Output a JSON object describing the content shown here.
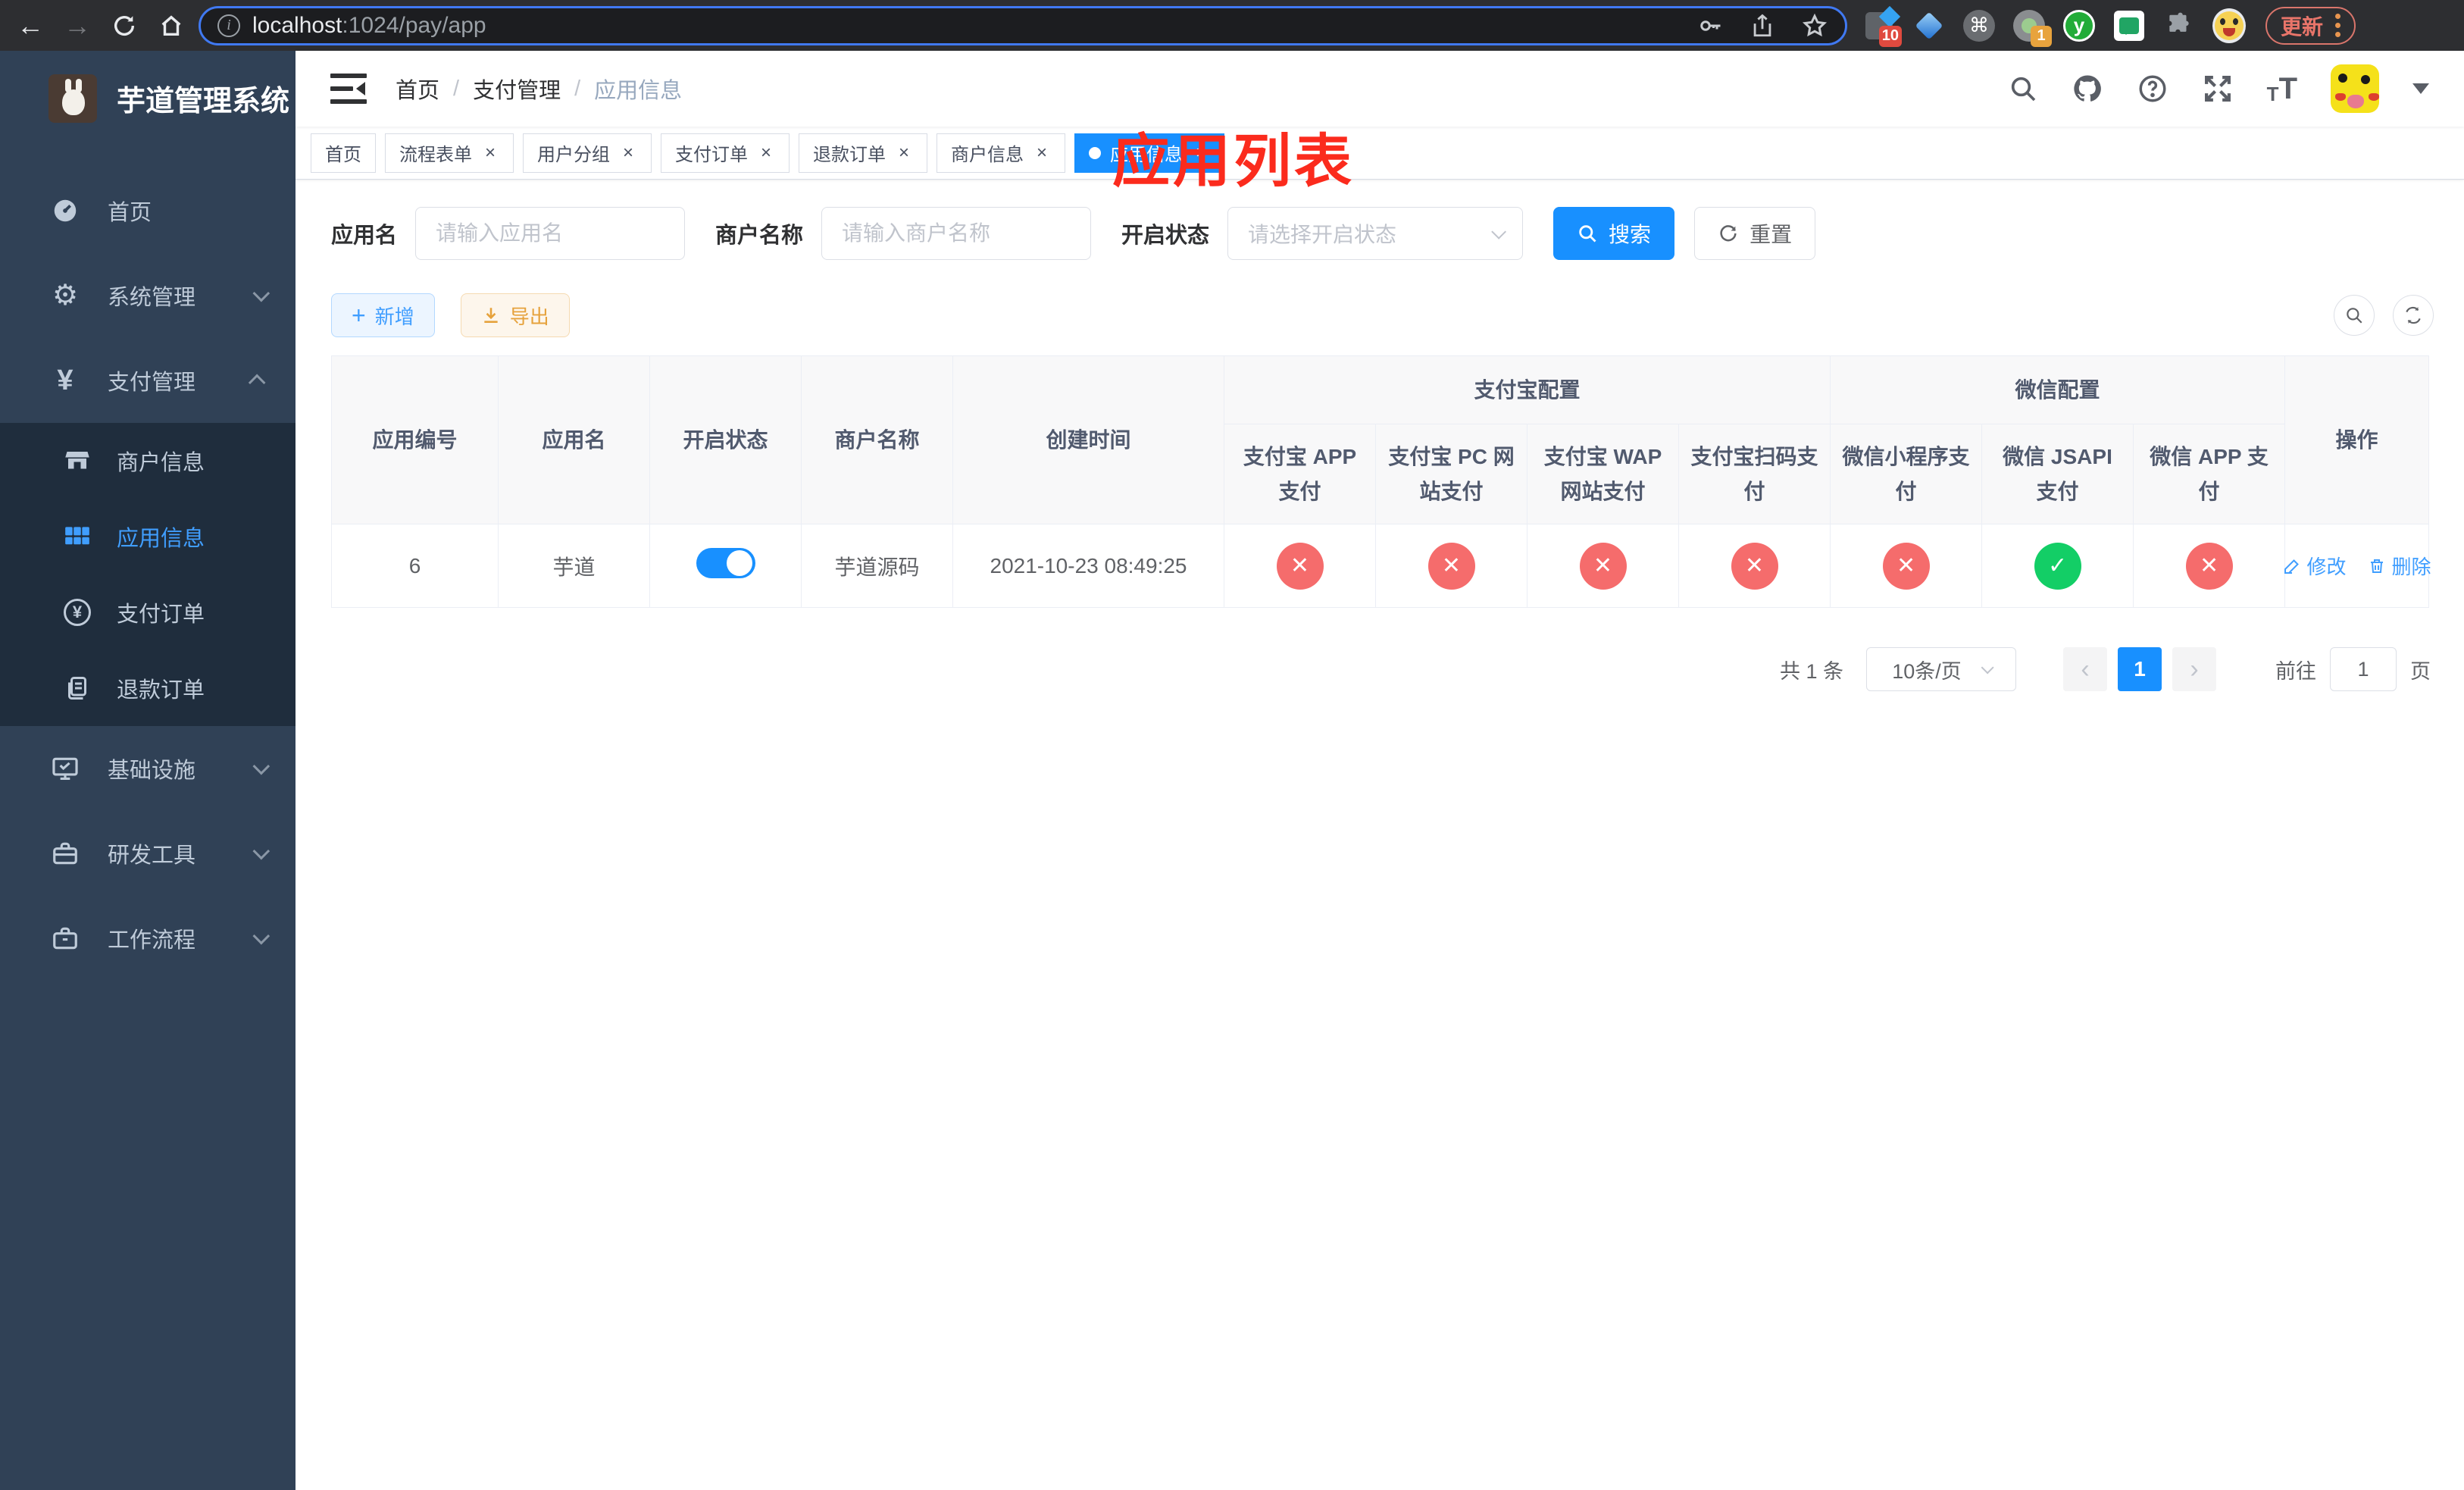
{
  "browser": {
    "url_host": "localhost",
    "url_rest": ":1024/pay/app",
    "ext_badge_10": "10",
    "ext_badge_1": "1",
    "ext_letter_y": "y",
    "update_label": "更新"
  },
  "sidebar": {
    "title": "芋道管理系统",
    "menu": [
      {
        "label": "首页"
      },
      {
        "label": "系统管理"
      },
      {
        "label": "支付管理"
      },
      {
        "label": "基础设施"
      },
      {
        "label": "研发工具"
      },
      {
        "label": "工作流程"
      }
    ],
    "submenu": [
      {
        "label": "商户信息"
      },
      {
        "label": "应用信息",
        "active": true
      },
      {
        "label": "支付订单"
      },
      {
        "label": "退款订单"
      }
    ]
  },
  "navbar": {
    "breadcrumb": [
      "首页",
      "支付管理",
      "应用信息"
    ],
    "separator": "/"
  },
  "annotation": "应用列表",
  "tabs": {
    "items": [
      {
        "label": "首页",
        "closable": false
      },
      {
        "label": "流程表单",
        "closable": true
      },
      {
        "label": "用户分组",
        "closable": true
      },
      {
        "label": "支付订单",
        "closable": true
      },
      {
        "label": "退款订单",
        "closable": true
      },
      {
        "label": "商户信息",
        "closable": true
      },
      {
        "label": "应用信息",
        "closable": true,
        "active": true
      }
    ]
  },
  "filters": {
    "app_name_label": "应用名",
    "app_name_placeholder": "请输入应用名",
    "merchant_label": "商户名称",
    "merchant_placeholder": "请输入商户名称",
    "status_label": "开启状态",
    "status_placeholder": "请选择开启状态",
    "search_label": "搜索",
    "reset_label": "重置"
  },
  "toolbar": {
    "add_label": "新增",
    "export_label": "导出"
  },
  "table": {
    "main_headers": [
      "应用编号",
      "应用名",
      "开启状态",
      "商户名称",
      "创建时间"
    ],
    "groups": [
      {
        "label": "支付宝配置",
        "children": [
          "支付宝 APP 支付",
          "支付宝 PC 网站支付",
          "支付宝 WAP 网站支付",
          "支付宝扫码支付"
        ]
      },
      {
        "label": "微信配置",
        "children": [
          "微信小程序支付",
          "微信 JSAPI 支付",
          "微信 APP 支付"
        ]
      }
    ],
    "actions_header": "操作",
    "rows": [
      {
        "app_id": "6",
        "app_name": "芋道",
        "enabled": true,
        "merchant_name": "芋道源码",
        "create_time": "2021-10-23 08:49:25",
        "pay_status": [
          "cross",
          "cross",
          "cross",
          "cross",
          "cross",
          "check",
          "cross"
        ]
      }
    ],
    "edit_label": "修改",
    "delete_label": "删除"
  },
  "pagination": {
    "total": "共 1 条",
    "page_size": "10条/页",
    "prev": "‹",
    "next": "›",
    "current_page": "1",
    "goto_label": "前往",
    "goto_value": "1",
    "goto_unit": "页"
  },
  "glyphs": {
    "close": "×",
    "check": "✓",
    "cross": "✕",
    "plus": "+",
    "yen": "¥",
    "back": "←",
    "forward": "→",
    "cmd": "⌘",
    "gear": "⚙",
    "question": "?",
    "info": "i",
    "t": "T"
  },
  "colors": {
    "primary": "#1890ff",
    "link_blue": "#409eff",
    "success": "#13ce66",
    "danger": "#f56c6c",
    "warning": "#e6a23c",
    "annotation_red": "#fb2b1d",
    "sidebar_bg": "#304156",
    "submenu_bg": "#1f2d3d"
  }
}
